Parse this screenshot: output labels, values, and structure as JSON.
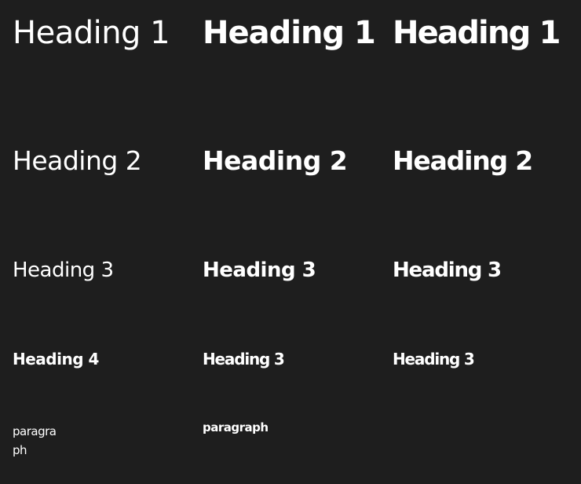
{
  "headings": {
    "h1": [
      "Heading 1",
      "Heading 1",
      "Heading 1"
    ],
    "h2": [
      "Heading 2",
      "Heading 2",
      "Heading 2"
    ],
    "h3": [
      "Heading 3",
      "Heading 3",
      "Heading 3"
    ],
    "h4": [
      "Heading 4",
      "Heading 3",
      "Heading 3"
    ]
  },
  "paragraphs": [
    "paragraph",
    "paragraph"
  ],
  "colors": {
    "background": "#1e1e1e",
    "text": "#ffffff"
  }
}
